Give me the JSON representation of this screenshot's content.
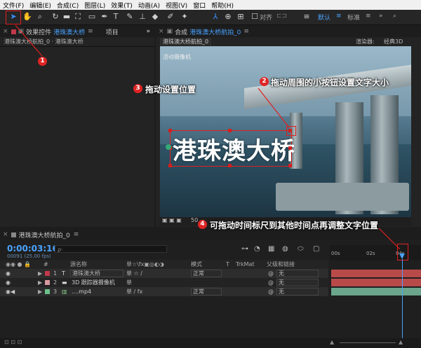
{
  "menu": [
    "文件(F)",
    "编辑(E)",
    "合成(C)",
    "图层(L)",
    "效果(T)",
    "动画(A)",
    "视图(V)",
    "窗口",
    "帮助(H)"
  ],
  "toolbar": {
    "snap_label": "对齐",
    "workspace_default": "默认",
    "workspace_standard": "标准",
    "more": "»"
  },
  "left_panel": {
    "tab_label": "效果控件",
    "tab_name": "港珠澳大桥",
    "project_tab": "项目",
    "breadcrumb": "港珠澳大桥航拍_0 · 港珠澳大桥"
  },
  "comp_panel": {
    "tab_prefix": "合成",
    "tab_name": "港珠澳大桥航拍_0",
    "subtab": "港珠澳大桥航拍_0",
    "renderer_label": "渲染器:",
    "renderer_value": "经典3D",
    "camera_label": "活动摄像机",
    "zoom": "50"
  },
  "overlay_text": "港珠澳大桥",
  "annotations": [
    {
      "num": "1",
      "text": ""
    },
    {
      "num": "2",
      "text": "拖动周围的小按钮设置文字大小"
    },
    {
      "num": "3",
      "text": "拖动设置位置"
    },
    {
      "num": "4",
      "text": "可拖动时间标尺到其他时间点再调整文字位置"
    }
  ],
  "timeline": {
    "tab_name": "港珠澳大桥航拍_0",
    "timecode": "0:00:03:16",
    "fps": "00091 (25.00 fps)",
    "search_placeholder": "ρ·",
    "headers": {
      "num": "#",
      "source": "源名称",
      "switches": "单☆\\fx▣◎◐◑",
      "mode": "模式",
      "t": "T",
      "trkmat": "TrkMat",
      "parent": "父级和链接"
    },
    "ruler": [
      "00s",
      "02s",
      "04s"
    ],
    "layers": [
      {
        "index": "1",
        "type": "T",
        "name": "港珠澳大桥",
        "mode": "正常",
        "parent": "无",
        "color": "#c0384a",
        "bar": "#b84a4a"
      },
      {
        "index": "2",
        "type": "cam",
        "name": "3D 跟踪器摄像机",
        "mode": "",
        "parent": "无",
        "color": "#d89aa0",
        "bar": "#b84a4a"
      },
      {
        "index": "3",
        "type": "vid",
        "name": "....mp4",
        "mode": "正常",
        "parent": "无",
        "color": "#6cc08a",
        "bar": "#6aa58c"
      }
    ]
  }
}
